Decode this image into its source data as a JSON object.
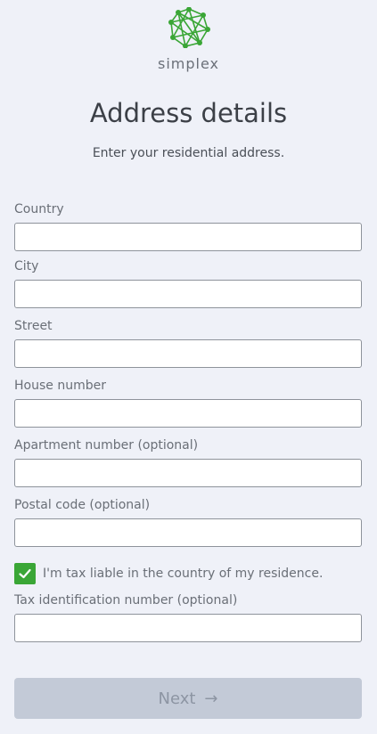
{
  "brand": {
    "name": "simplex",
    "accent_color": "#3aa636"
  },
  "header": {
    "title": "Address details",
    "subtitle": "Enter your residential address."
  },
  "form": {
    "country": {
      "label": "Country",
      "value": ""
    },
    "city": {
      "label": "City",
      "value": ""
    },
    "street": {
      "label": "Street",
      "value": ""
    },
    "house_number": {
      "label": "House number",
      "value": ""
    },
    "apartment_number": {
      "label": "Apartment number (optional)",
      "value": ""
    },
    "postal_code": {
      "label": "Postal code (optional)",
      "value": ""
    },
    "tax_liable": {
      "label": "I'm tax liable in the country of my residence.",
      "checked": true
    },
    "tax_id": {
      "label": "Tax identification number (optional)",
      "value": ""
    }
  },
  "actions": {
    "next_label": "Next",
    "next_icon": "arrow-right-icon",
    "next_enabled": false
  }
}
